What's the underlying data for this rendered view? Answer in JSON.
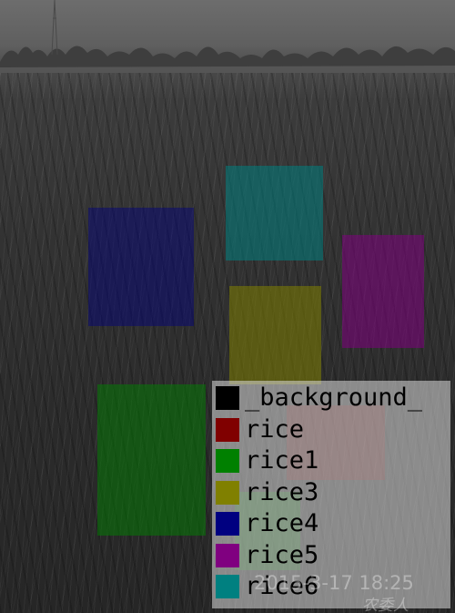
{
  "image": {
    "scene": "grayscale photo of a rice paddy field with a tree line on the horizon",
    "timestamp": "2015-3-17 18:25",
    "watermark": "农委人"
  },
  "boxes": [
    {
      "label": "rice6",
      "color": "#008080"
    },
    {
      "label": "rice4",
      "color": "#000080"
    },
    {
      "label": "rice5",
      "color": "#800080"
    },
    {
      "label": "rice3",
      "color": "#808000"
    },
    {
      "label": "rice1",
      "color": "#008000"
    },
    {
      "label": "rice",
      "color": "#800000"
    },
    {
      "label": "rice1",
      "color": "#008000"
    }
  ],
  "legend": {
    "items": [
      {
        "label": "_background_",
        "color": "#000000"
      },
      {
        "label": "rice",
        "color": "#800000"
      },
      {
        "label": "rice1",
        "color": "#008000"
      },
      {
        "label": "rice3",
        "color": "#808000"
      },
      {
        "label": "rice4",
        "color": "#000080"
      },
      {
        "label": "rice5",
        "color": "#800080"
      },
      {
        "label": "rice6",
        "color": "#008080"
      }
    ]
  }
}
